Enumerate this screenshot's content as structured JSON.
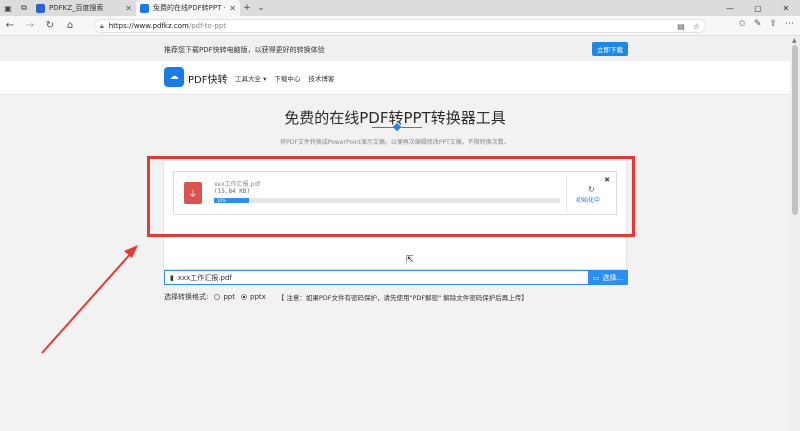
{
  "tabs": [
    {
      "label": "PDFKZ_百度搜索",
      "fav_color": "#2a63d6"
    },
    {
      "label": "免费的在线PDF转PPT -",
      "fav_color": "#1a7ae6"
    }
  ],
  "url": {
    "host": "https://www.pdfkz.com",
    "path": "/pdf-to-ppt"
  },
  "promo": {
    "text": "推荐您下载PDF快转电脑版，以获得更好的转换体验",
    "button": "立即下载"
  },
  "site": {
    "brand": "PDF快转",
    "nav": [
      "工具大全 ▾",
      "下载中心",
      "技术博客"
    ]
  },
  "main": {
    "title": "免费的在线PDF转PPT转换器工具",
    "subtitle": "将PDF文件转换成PowerPoint演示文稿，以便再次编辑修改PPT文稿，不限转换次数。"
  },
  "file": {
    "name": "xxx工作汇报.pdf",
    "size": "(15.84 KB)",
    "progress_label": "10%",
    "progress": 0.1,
    "status": "初始化中"
  },
  "picker": {
    "value": "xxx工作汇报.pdf",
    "button": "选择..."
  },
  "format": {
    "label": "选择转换格式:",
    "options": [
      "ppt",
      "pptx"
    ],
    "selected": "pptx",
    "note": "【 注意：如果PDF文件有密码保护，请先使用\"PDF解密\" 解除文件密码保护后再上传】"
  },
  "colors": {
    "accent": "#1e88e5",
    "highlight": "#e53935",
    "pdf_red": "#d9534f"
  }
}
